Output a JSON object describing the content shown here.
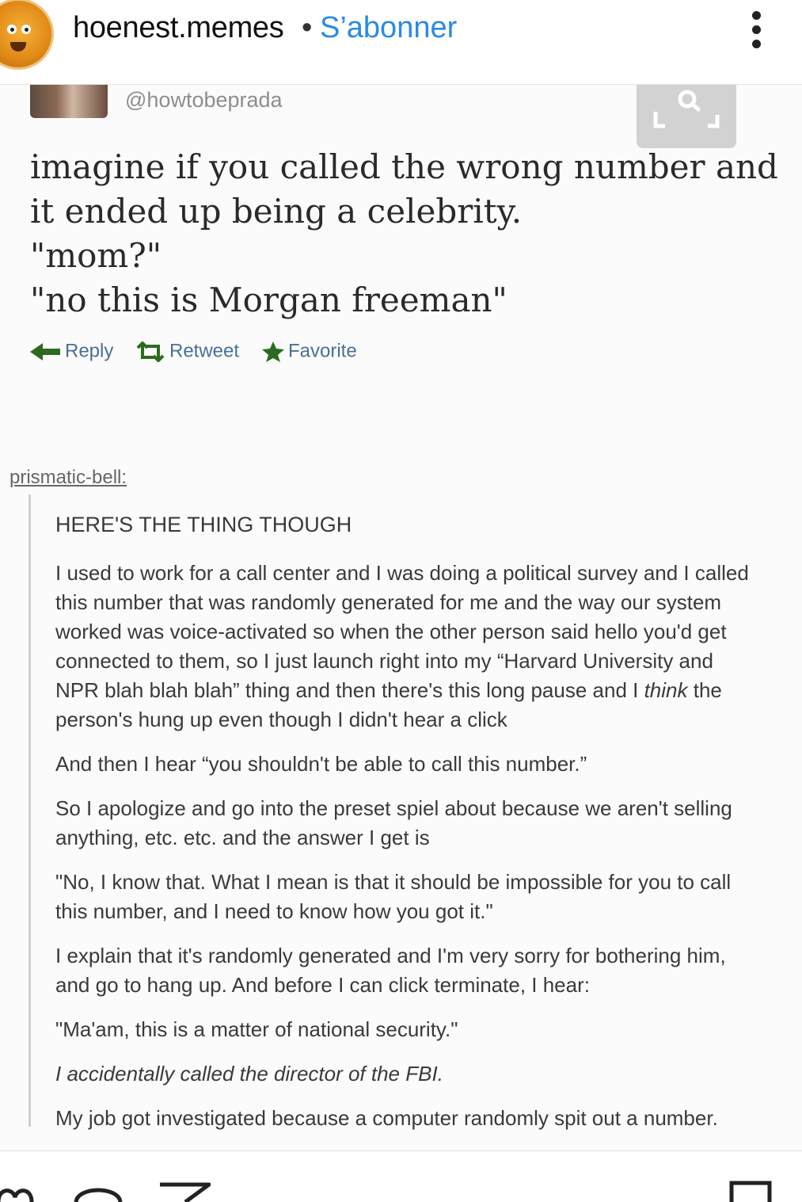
{
  "header": {
    "username": "hoenest.memes",
    "separator": "•",
    "subscribe_label": "S’abonner"
  },
  "tweet": {
    "handle": "@howtobeprada",
    "lines": [
      "imagine if you called the wrong number and",
      "it ended up being a celebrity.",
      "\"mom?\"",
      "\"no this is Morgan freeman\""
    ],
    "actions": {
      "reply": "Reply",
      "retweet": "Retweet",
      "favorite": "Favorite"
    }
  },
  "reblog": {
    "author": "prismatic-bell",
    "colon": ":",
    "heading": "HERE'S THE THING THOUGH",
    "p1": "I used to work for a call center and I was doing a political survey and I called this number that was randomly generated for me and the way our system worked was voice-activated so when the other person said hello you'd get connected to them, so I just launch right into my “Harvard University and NPR blah blah blah” thing and then there's this long pause and I ",
    "p1_italic": "think",
    "p1_end": " the person's hung up even though I didn't hear a click",
    "p2": "And then I hear “you shouldn't be able to call this number.”",
    "p3": "So I apologize and go into the preset spiel about because we aren't selling anything, etc. etc. and the answer I get is",
    "p4": "\"No, I know that. What I mean is that it should be impossible for you to call this number, and I need to know how you got it.\"",
    "p5": "I explain that it's randomly generated and I'm very sorry for bothering him, and go to hang up. And before I can click terminate, I hear:",
    "p6": "\"Ma'am, this is a matter of national security.\"",
    "p7": "I accidentally called the director of the FBI.",
    "p8": "My job got investigated because a computer randomly spit out a number."
  },
  "icons": {
    "more": "more-vertical-icon",
    "like": "heart-icon",
    "comment": "comment-icon",
    "share": "send-icon",
    "save": "bookmark-icon",
    "image_search": "image-search-icon"
  },
  "colors": {
    "subscribe": "#2a8ae6",
    "twitter_action": "#4b6f96"
  }
}
